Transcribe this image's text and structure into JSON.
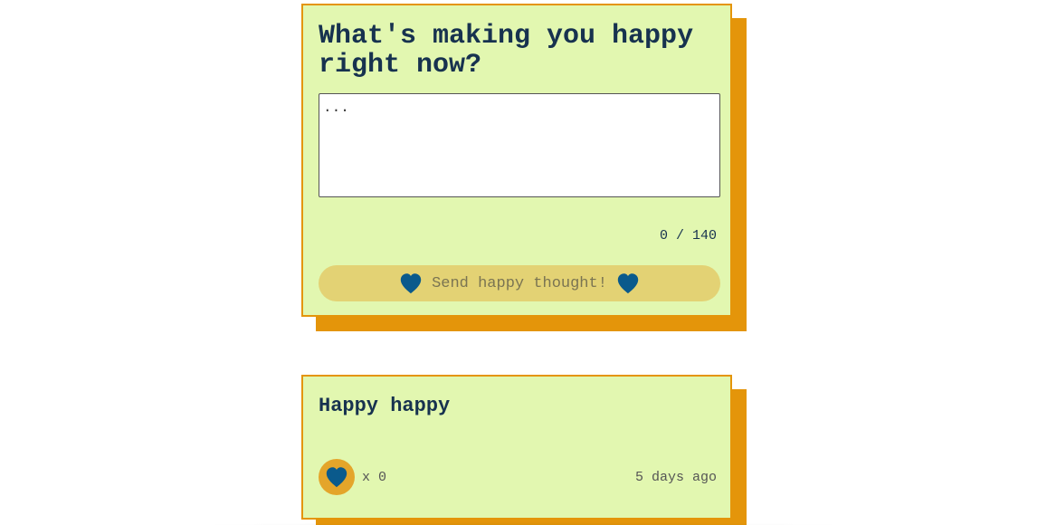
{
  "form": {
    "title": "What's making you happy right now?",
    "input_placeholder": "...",
    "input_value": "",
    "char_counter": "0 / 140",
    "send_label": "Send happy thought!",
    "heart_icon": "heart-icon"
  },
  "thoughts": [
    {
      "message": "Happy happy",
      "like_count": "x 0",
      "timestamp": "5 days ago"
    }
  ],
  "colors": {
    "card_background": "#e2f7b0",
    "card_border": "#e4950a",
    "heading": "#17324f",
    "heart": "#0a5a8c",
    "send_button": "#e3d274",
    "like_button": "#e4a52a"
  }
}
